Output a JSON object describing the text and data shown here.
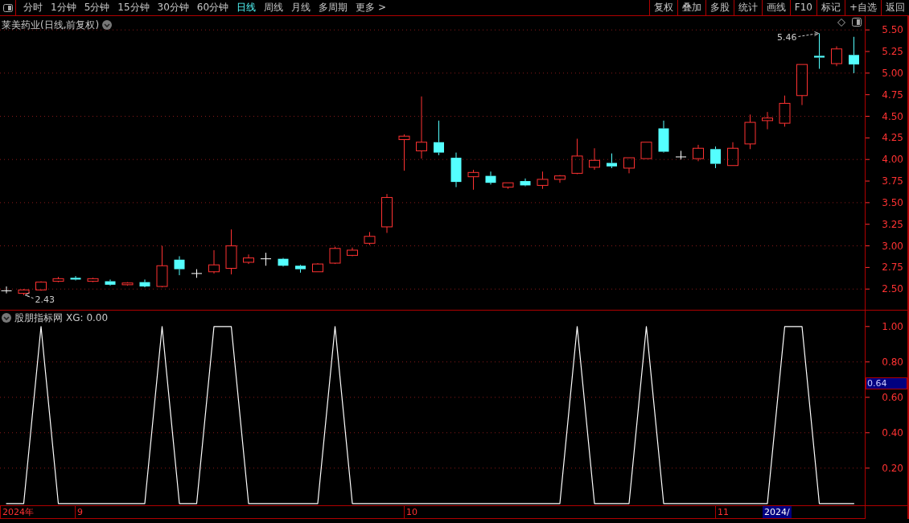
{
  "toolbar": {
    "periods": [
      {
        "label": "分时",
        "selected": false
      },
      {
        "label": "1分钟",
        "selected": false
      },
      {
        "label": "5分钟",
        "selected": false
      },
      {
        "label": "15分钟",
        "selected": false
      },
      {
        "label": "30分钟",
        "selected": false
      },
      {
        "label": "60分钟",
        "selected": false
      },
      {
        "label": "日线",
        "selected": true
      },
      {
        "label": "周线",
        "selected": false
      },
      {
        "label": "月线",
        "selected": false
      },
      {
        "label": "多周期",
        "selected": false
      },
      {
        "label": "更多 >",
        "selected": false
      }
    ],
    "buttons": [
      "复权",
      "叠加",
      "多股",
      "统计",
      "画线",
      "F10",
      "标记",
      "+自选",
      "返回"
    ]
  },
  "main_chart": {
    "title": "莱美药业(日线,前复权)",
    "chart_data": {
      "type": "candlestick",
      "ylim": [
        2.26,
        5.66
      ],
      "grid": true,
      "yticks": [
        {
          "value": 5.5,
          "label": "5.50"
        },
        {
          "value": 5.25,
          "label": "5.25"
        },
        {
          "value": 5,
          "label": "5.00"
        },
        {
          "value": 4.75,
          "label": "4.75"
        },
        {
          "value": 4.5,
          "label": "4.50"
        },
        {
          "value": 4.25,
          "label": "4.25"
        },
        {
          "value": 4,
          "label": "4.00"
        },
        {
          "value": 3.75,
          "label": "3.75"
        },
        {
          "value": 3.5,
          "label": "3.50"
        },
        {
          "value": 3.25,
          "label": "3.25"
        },
        {
          "value": 3,
          "label": "3.00"
        },
        {
          "value": 2.75,
          "label": "2.75"
        },
        {
          "value": 2.5,
          "label": "2.50"
        }
      ],
      "ohlc": [
        [
          2.48,
          2.53,
          2.45,
          2.48
        ],
        [
          2.45,
          2.5,
          2.43,
          2.49
        ],
        [
          2.49,
          2.59,
          2.48,
          2.58
        ],
        [
          2.59,
          2.64,
          2.58,
          2.62
        ],
        [
          2.63,
          2.65,
          2.6,
          2.61
        ],
        [
          2.59,
          2.63,
          2.58,
          2.62
        ],
        [
          2.59,
          2.61,
          2.54,
          2.55
        ],
        [
          2.55,
          2.58,
          2.54,
          2.57
        ],
        [
          2.58,
          2.61,
          2.52,
          2.53
        ],
        [
          2.53,
          3.0,
          2.52,
          2.77
        ],
        [
          2.84,
          2.88,
          2.66,
          2.73
        ],
        [
          2.68,
          2.73,
          2.63,
          2.68
        ],
        [
          2.7,
          2.95,
          2.68,
          2.78
        ],
        [
          2.74,
          3.19,
          2.67,
          3.0
        ],
        [
          2.81,
          2.9,
          2.79,
          2.86
        ],
        [
          2.85,
          2.92,
          2.77,
          2.85
        ],
        [
          2.85,
          2.86,
          2.76,
          2.77
        ],
        [
          2.77,
          2.78,
          2.69,
          2.73
        ],
        [
          2.7,
          2.8,
          2.7,
          2.79
        ],
        [
          2.8,
          2.99,
          2.79,
          2.97
        ],
        [
          2.89,
          2.98,
          2.88,
          2.95
        ],
        [
          3.03,
          3.16,
          3.01,
          3.11
        ],
        [
          3.22,
          3.6,
          3.15,
          3.56
        ],
        [
          4.23,
          4.29,
          3.87,
          4.27
        ],
        [
          4.1,
          4.73,
          4.01,
          4.2
        ],
        [
          4.2,
          4.45,
          4.05,
          4.08
        ],
        [
          4.02,
          4.08,
          3.68,
          3.74
        ],
        [
          3.8,
          3.88,
          3.65,
          3.85
        ],
        [
          3.81,
          3.86,
          3.71,
          3.73
        ],
        [
          3.68,
          3.73,
          3.66,
          3.73
        ],
        [
          3.75,
          3.78,
          3.69,
          3.7
        ],
        [
          3.7,
          3.86,
          3.66,
          3.77
        ],
        [
          3.77,
          3.82,
          3.73,
          3.81
        ],
        [
          3.84,
          4.24,
          3.83,
          4.04
        ],
        [
          3.91,
          4.13,
          3.88,
          3.99
        ],
        [
          3.96,
          4.07,
          3.9,
          3.92
        ],
        [
          3.9,
          4.02,
          3.84,
          4.02
        ],
        [
          4.01,
          4.2,
          4.01,
          4.2
        ],
        [
          4.36,
          4.45,
          4.08,
          4.09
        ],
        [
          4.03,
          4.1,
          4.0,
          4.03
        ],
        [
          4.01,
          4.17,
          3.98,
          4.13
        ],
        [
          4.12,
          4.15,
          3.9,
          3.95
        ],
        [
          3.93,
          4.2,
          3.93,
          4.13
        ],
        [
          4.18,
          4.52,
          4.12,
          4.43
        ],
        [
          4.45,
          4.55,
          4.35,
          4.48
        ],
        [
          4.42,
          4.74,
          4.38,
          4.65
        ],
        [
          4.74,
          5.1,
          4.63,
          5.1
        ],
        [
          5.2,
          5.46,
          5.05,
          5.18
        ],
        [
          5.11,
          5.31,
          5.08,
          5.28
        ],
        [
          5.21,
          5.42,
          5.0,
          5.1
        ]
      ],
      "annotations": [
        "5.46",
        "2.43"
      ]
    }
  },
  "indicator": {
    "name": "股朋指标网",
    "reading": "XG: 0.00",
    "cursor_label": "0.64",
    "chart_data": {
      "type": "line",
      "ylim": [
        -0.01,
        1.09
      ],
      "grid": true,
      "yticks": [
        {
          "value": 1,
          "label": "1.00"
        },
        {
          "value": 0.8,
          "label": "0.80"
        },
        {
          "value": 0.6,
          "label": "0.60"
        },
        {
          "value": 0.4,
          "label": "0.40"
        },
        {
          "value": 0.2,
          "label": "0.20"
        }
      ],
      "series": [
        {
          "color": "#ffffff",
          "values": [
            0,
            0,
            1,
            0,
            0,
            0,
            0,
            0,
            0,
            1,
            0,
            0,
            1,
            1,
            0,
            0,
            0,
            0,
            0,
            1,
            0,
            0,
            0,
            0,
            0,
            0,
            0,
            0,
            0,
            0,
            0,
            0,
            0,
            1,
            0,
            0,
            0,
            1,
            0,
            0,
            0,
            0,
            0,
            0,
            0,
            1,
            1,
            0,
            0,
            0
          ]
        }
      ]
    }
  },
  "date_labels": [
    "2024年",
    "9",
    "10",
    "11"
  ],
  "date_cursor": "2024/"
}
